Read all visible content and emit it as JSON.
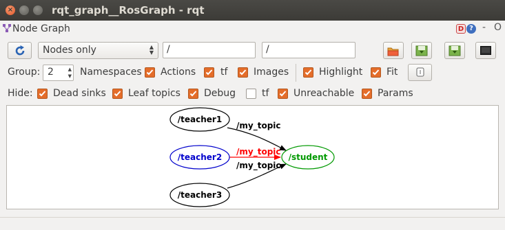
{
  "window": {
    "title": "rqt_graph__RosGraph - rqt"
  },
  "plugin": {
    "title": "Node Graph",
    "header_buttons": {
      "debug": "D",
      "help": "?",
      "minimize": "-",
      "close": "O"
    }
  },
  "toolbar": {
    "refresh_icon": "refresh-icon",
    "view_mode": {
      "selected": "Nodes only"
    },
    "node_filter": "/",
    "topic_filter": "/",
    "icons": [
      "open-folder-icon",
      "save-dot-icon",
      "save-svg-icon",
      "screenshot-icon"
    ]
  },
  "group_row": {
    "group_label": "Group:",
    "group_value": "2",
    "options": [
      {
        "label": "Namespaces",
        "checked": true
      },
      {
        "label": "Actions",
        "checked": true
      },
      {
        "label": "tf",
        "checked": true
      },
      {
        "label": "Images",
        "checked": true
      },
      {
        "label": "Highlight",
        "checked": true
      },
      {
        "label": "Fit",
        "checked": true
      }
    ],
    "fit_button_icon": "fit-view-icon"
  },
  "hide_row": {
    "hide_label": "Hide:",
    "options": [
      {
        "label": "Dead sinks",
        "checked": true
      },
      {
        "label": "Leaf topics",
        "checked": true
      },
      {
        "label": "Debug",
        "checked": true
      },
      {
        "label": "tf",
        "checked": false
      },
      {
        "label": "Unreachable",
        "checked": true
      },
      {
        "label": "Params",
        "checked": true
      }
    ]
  },
  "graph": {
    "nodes": [
      {
        "name": "/teacher1",
        "color": "#000000"
      },
      {
        "name": "/teacher2",
        "color": "#0000cc"
      },
      {
        "name": "/teacher3",
        "color": "#000000"
      },
      {
        "name": "/student",
        "color": "#009900"
      }
    ],
    "edges": [
      {
        "from": "/teacher1",
        "to": "/student",
        "label": "/my_topic",
        "color": "#000000"
      },
      {
        "from": "/teacher2",
        "to": "/student",
        "label": "/my_topic",
        "color": "#ff0000"
      },
      {
        "from": "/teacher3",
        "to": "/student",
        "label": "/my_topic",
        "color": "#000000"
      }
    ]
  }
}
